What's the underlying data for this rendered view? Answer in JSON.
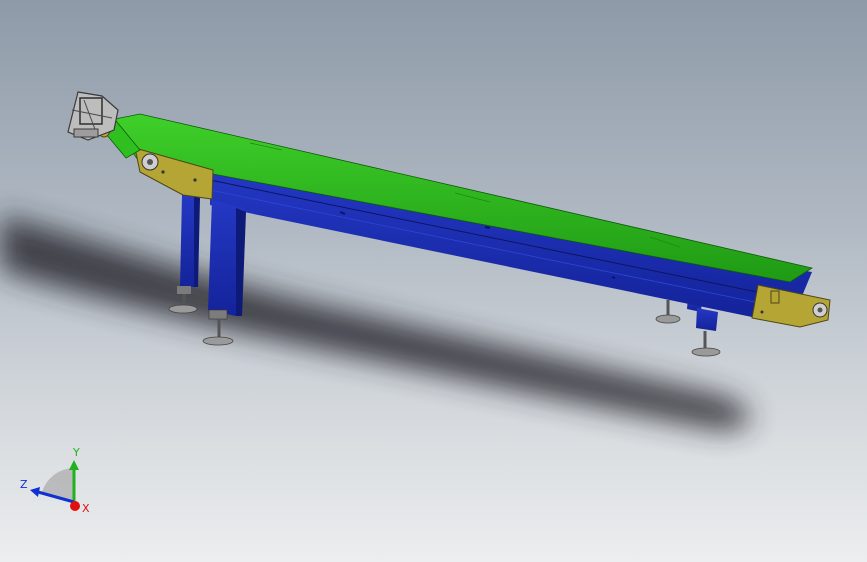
{
  "viewport": {
    "background_top": "#8e9aa8",
    "background_bottom": "#eceeef"
  },
  "model": {
    "belt_color": "#2fbf1f",
    "frame_color": "#1a2fb0",
    "end_plate_color": "#b5a534",
    "roller_color": "#c9c9c9"
  },
  "triad": {
    "x_label": "X",
    "y_label": "Y",
    "z_label": "Z",
    "x_color": "#e01010",
    "y_color": "#20b020",
    "z_color": "#1030d0"
  }
}
